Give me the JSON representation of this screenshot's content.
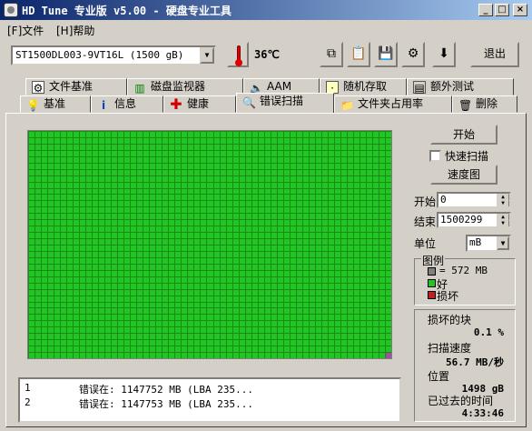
{
  "window": {
    "title": "HD Tune 专业版 v5.00 - 硬盘专业工具",
    "controls": [
      "_",
      "□",
      "×"
    ]
  },
  "menu": {
    "items": [
      "[F]文件",
      "[H]帮助"
    ]
  },
  "toolbar": {
    "drive": "ST1500DL003-9VT16L (1500 gB)",
    "temperature": "36℃",
    "exit_label": "退出",
    "buttons": [
      "copy-icon",
      "paste-icon",
      "save-icon",
      "options-icon",
      "down-arrow-icon"
    ]
  },
  "tabs": {
    "row1": [
      {
        "label": "文件基准",
        "icon": "file-benchmark-icon"
      },
      {
        "label": "磁盘监视器",
        "icon": "disk-monitor-icon"
      },
      {
        "label": "AAM",
        "icon": "speaker-icon"
      },
      {
        "label": "随机存取",
        "icon": "random-access-icon"
      },
      {
        "label": "额外测试",
        "icon": "extra-tests-icon"
      }
    ],
    "row2": [
      {
        "label": "基准",
        "icon": "lightbulb-icon"
      },
      {
        "label": "信息",
        "icon": "info-icon"
      },
      {
        "label": "健康",
        "icon": "health-cross-icon"
      },
      {
        "label": "错误扫描",
        "icon": "magnifier-icon"
      },
      {
        "label": "文件夹占用率",
        "icon": "folder-icon"
      },
      {
        "label": "删除",
        "icon": "trash-icon"
      }
    ],
    "active": "错误扫描"
  },
  "scan": {
    "start_label": "开始",
    "quick_scan_label": "快速扫描",
    "quick_scan_checked": false,
    "speed_map_label": "速度图",
    "start_field_label": "开始",
    "start_value": "0",
    "end_field_label": "结束",
    "end_value": "1500299",
    "unit_label": "单位",
    "unit_value": "mB",
    "legend_title": "图例",
    "legend": [
      {
        "label": "= 572 MB",
        "color": "#808080"
      },
      {
        "label": "好",
        "color": "#22c622"
      },
      {
        "label": "损坏",
        "color": "#c02020"
      }
    ],
    "grid_cols": 57,
    "grid_rows": 36,
    "bad_blocks": [
      [
        41,
        6
      ],
      [
        41,
        7
      ]
    ],
    "current_block": [
      35,
      56
    ],
    "colors": {
      "good": "#22c622",
      "grid_line": "#1a8a1a",
      "bad": "#c02020",
      "current": "#a050a0"
    }
  },
  "stats": {
    "damaged_label": "损坏的块",
    "damaged_value": "0.1 %",
    "speed_label": "扫描速度",
    "speed_value": "56.7 MB/秒",
    "position_label": "位置",
    "position_value": "1498 gB",
    "elapsed_label": "已过去的时间",
    "elapsed_value": "4:33:46"
  },
  "log": [
    {
      "num": "1",
      "msg": "错误在:  1147752 MB  (LBA 235..."
    },
    {
      "num": "2",
      "msg": "错误在:  1147753 MB  (LBA 235..."
    }
  ]
}
